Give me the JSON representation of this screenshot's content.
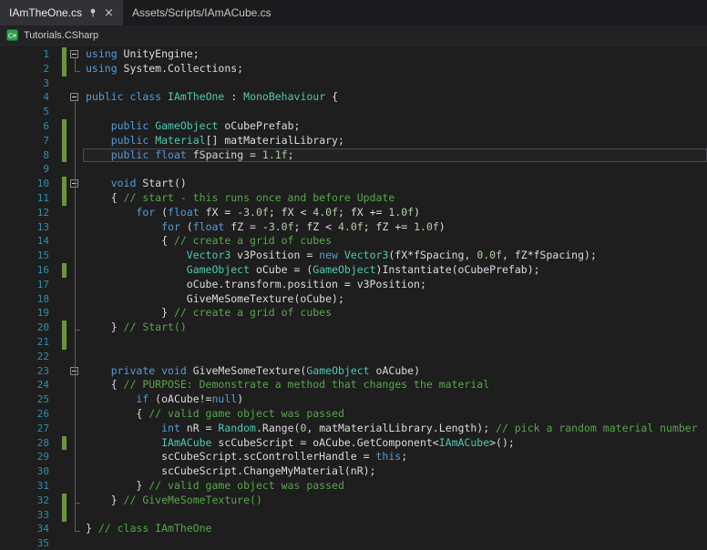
{
  "tabs": [
    {
      "label": "IAmTheOne.cs",
      "active": true
    },
    {
      "label": "Assets/Scripts/IAmACube.cs",
      "active": false
    }
  ],
  "navbar": {
    "project": "Tutorials.CSharp"
  },
  "colors": {
    "background": "#1E1E1E",
    "keyword": "#569CD6",
    "type": "#4EC9B0",
    "comment": "#57A64A",
    "number": "#B5CEA8",
    "text": "#DCDCDC",
    "line_number": "#2B91AF",
    "change_bar": "#6B9440",
    "tab_bar": "#1B1B1E",
    "active_tab": "#313136"
  },
  "editor": {
    "current_line": 8,
    "fold_markers": [
      1,
      4,
      10,
      23
    ],
    "outline_spans": [
      {
        "from": 1,
        "to": 2
      },
      {
        "from": 4,
        "to": 34
      },
      {
        "from": 10,
        "to": 20
      },
      {
        "from": 23,
        "to": 32
      }
    ],
    "change_bars": [
      [
        1,
        2
      ],
      [
        6,
        8
      ],
      [
        10,
        11
      ],
      [
        16,
        16
      ],
      [
        20,
        21
      ],
      [
        28,
        28
      ],
      [
        32,
        33
      ]
    ],
    "lines": [
      [
        [
          "k",
          "using"
        ],
        [
          "p",
          " UnityEngine;"
        ]
      ],
      [
        [
          "k",
          "using"
        ],
        [
          "p",
          " System.Collections;"
        ]
      ],
      [],
      [
        [
          "k",
          "public"
        ],
        [
          "p",
          " "
        ],
        [
          "k",
          "class"
        ],
        [
          "p",
          " "
        ],
        [
          "t",
          "IAmTheOne"
        ],
        [
          "p",
          " : "
        ],
        [
          "t",
          "MonoBehaviour"
        ],
        [
          "p",
          " {"
        ]
      ],
      [],
      [
        [
          "p",
          "    "
        ],
        [
          "k",
          "public"
        ],
        [
          "p",
          " "
        ],
        [
          "t",
          "GameObject"
        ],
        [
          "p",
          " oCubePrefab;"
        ]
      ],
      [
        [
          "p",
          "    "
        ],
        [
          "k",
          "public"
        ],
        [
          "p",
          " "
        ],
        [
          "t",
          "Material"
        ],
        [
          "p",
          "[] matMaterialLibrary;"
        ]
      ],
      [
        [
          "p",
          "    "
        ],
        [
          "k",
          "public"
        ],
        [
          "p",
          " "
        ],
        [
          "k",
          "float"
        ],
        [
          "p",
          " fSpacing = "
        ],
        [
          "n",
          "1.1f"
        ],
        [
          "p",
          ";"
        ]
      ],
      [],
      [
        [
          "p",
          "    "
        ],
        [
          "k",
          "void"
        ],
        [
          "p",
          " Start()"
        ]
      ],
      [
        [
          "p",
          "    { "
        ],
        [
          "c",
          "// start - this runs once and before Update"
        ]
      ],
      [
        [
          "p",
          "        "
        ],
        [
          "k",
          "for"
        ],
        [
          "p",
          " ("
        ],
        [
          "k",
          "float"
        ],
        [
          "p",
          " fX = -"
        ],
        [
          "n",
          "3.0f"
        ],
        [
          "p",
          "; fX < "
        ],
        [
          "n",
          "4.0f"
        ],
        [
          "p",
          "; fX += "
        ],
        [
          "n",
          "1.0f"
        ],
        [
          "p",
          ")"
        ]
      ],
      [
        [
          "p",
          "            "
        ],
        [
          "k",
          "for"
        ],
        [
          "p",
          " ("
        ],
        [
          "k",
          "float"
        ],
        [
          "p",
          " fZ = -"
        ],
        [
          "n",
          "3.0f"
        ],
        [
          "p",
          "; fZ < "
        ],
        [
          "n",
          "4.0f"
        ],
        [
          "p",
          "; fZ += "
        ],
        [
          "n",
          "1.0f"
        ],
        [
          "p",
          ")"
        ]
      ],
      [
        [
          "p",
          "            { "
        ],
        [
          "c",
          "// create a grid of cubes"
        ]
      ],
      [
        [
          "p",
          "                "
        ],
        [
          "t",
          "Vector3"
        ],
        [
          "p",
          " v3Position = "
        ],
        [
          "k",
          "new"
        ],
        [
          "p",
          " "
        ],
        [
          "t",
          "Vector3"
        ],
        [
          "p",
          "(fX*fSpacing, "
        ],
        [
          "n",
          "0.0f"
        ],
        [
          "p",
          ", fZ*fSpacing);"
        ]
      ],
      [
        [
          "p",
          "                "
        ],
        [
          "t",
          "GameObject"
        ],
        [
          "p",
          " oCube = ("
        ],
        [
          "t",
          "GameObject"
        ],
        [
          "p",
          ")Instantiate(oCubePrefab);"
        ]
      ],
      [
        [
          "p",
          "                oCube.transform.position = v3Position;"
        ]
      ],
      [
        [
          "p",
          "                GiveMeSomeTexture(oCube);"
        ]
      ],
      [
        [
          "p",
          "            } "
        ],
        [
          "c",
          "// create a grid of cubes"
        ]
      ],
      [
        [
          "p",
          "    } "
        ],
        [
          "c",
          "// Start()"
        ]
      ],
      [],
      [],
      [
        [
          "p",
          "    "
        ],
        [
          "k",
          "private"
        ],
        [
          "p",
          " "
        ],
        [
          "k",
          "void"
        ],
        [
          "p",
          " GiveMeSomeTexture("
        ],
        [
          "t",
          "GameObject"
        ],
        [
          "p",
          " oACube)"
        ]
      ],
      [
        [
          "p",
          "    { "
        ],
        [
          "c",
          "// PURPOSE: Demonstrate a method that changes the material"
        ]
      ],
      [
        [
          "p",
          "        "
        ],
        [
          "k",
          "if"
        ],
        [
          "p",
          " (oACube!="
        ],
        [
          "k",
          "null"
        ],
        [
          "p",
          ")"
        ]
      ],
      [
        [
          "p",
          "        { "
        ],
        [
          "c",
          "// valid game object was passed"
        ]
      ],
      [
        [
          "p",
          "            "
        ],
        [
          "k",
          "int"
        ],
        [
          "p",
          " nR = "
        ],
        [
          "t",
          "Random"
        ],
        [
          "p",
          ".Range("
        ],
        [
          "n",
          "0"
        ],
        [
          "p",
          ", matMaterialLibrary.Length); "
        ],
        [
          "c",
          "// pick a random material number"
        ]
      ],
      [
        [
          "p",
          "            "
        ],
        [
          "t",
          "IAmACube"
        ],
        [
          "p",
          " scCubeScript = oACube.GetComponent<"
        ],
        [
          "t",
          "IAmACube"
        ],
        [
          "p",
          ">();"
        ]
      ],
      [
        [
          "p",
          "            scCubeScript.scControllerHandle = "
        ],
        [
          "k",
          "this"
        ],
        [
          "p",
          ";"
        ]
      ],
      [
        [
          "p",
          "            scCubeScript.ChangeMyMaterial(nR);"
        ]
      ],
      [
        [
          "p",
          "        } "
        ],
        [
          "c",
          "// valid game object was passed"
        ]
      ],
      [
        [
          "p",
          "    } "
        ],
        [
          "c",
          "// GiveMeSomeTexture()"
        ]
      ],
      [],
      [
        [
          "p",
          "} "
        ],
        [
          "c",
          "// class IAmTheOne"
        ]
      ],
      []
    ]
  }
}
